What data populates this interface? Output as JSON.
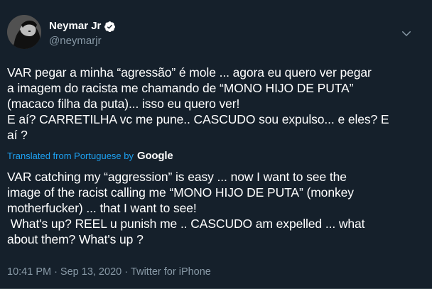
{
  "author": {
    "display_name": "Neymar Jr",
    "handle": "@neymarjr"
  },
  "tweet": {
    "original_lines": [
      "VAR pegar a minha “agressão” é mole ... agora eu quero ver pegar",
      "a imagem do racista me chamando de “MONO HIJO DE PUTA”",
      "(macaco filha da puta)... isso eu quero ver!",
      "E aí? CARRETILHA vc me pune.. CASCUDO sou expulso... e eles? E",
      "aí ?"
    ],
    "translated_from_label": "Translated from Portuguese by",
    "translation_provider": "Google",
    "translation_lines": [
      "VAR catching my “aggression” is easy ... now I want to see the",
      "image of the racist calling me “MONO HIJO DE PUTA” (monkey",
      "motherfucker) ... that I want to see!",
      " What's up? REEL u punish me .. CASCUDO am expelled ... what",
      "about them? What's up ?"
    ]
  },
  "meta": {
    "time": "10:41 PM",
    "separator": "·",
    "date": "Sep 13, 2020",
    "source": "Twitter for iPhone"
  },
  "colors": {
    "background": "#15202b",
    "text": "#ffffff",
    "secondary": "#8899a6",
    "accent": "#1da1f2"
  },
  "icons": {
    "verified": "verified-badge-icon",
    "menu": "chevron-down-icon"
  }
}
